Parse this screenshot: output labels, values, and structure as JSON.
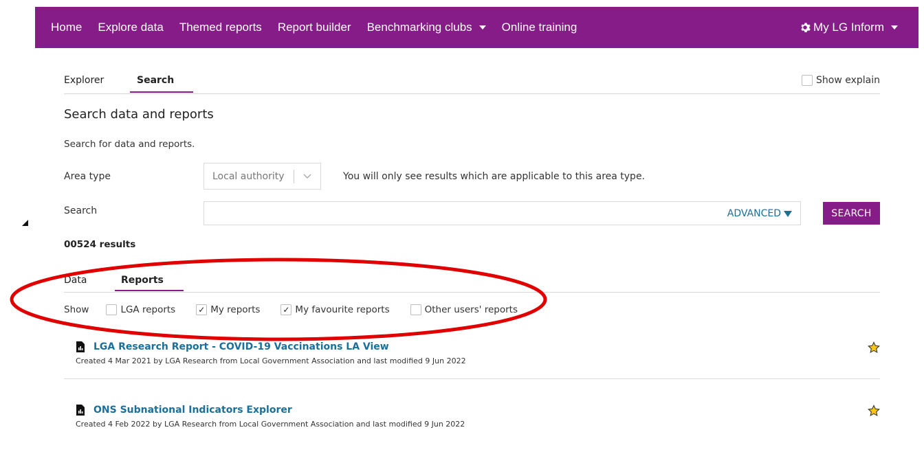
{
  "nav": {
    "items": [
      {
        "label": "Home",
        "dropdown": false
      },
      {
        "label": "Explore data",
        "dropdown": false
      },
      {
        "label": "Themed reports",
        "dropdown": false
      },
      {
        "label": "Report builder",
        "dropdown": false
      },
      {
        "label": "Benchmarking clubs",
        "dropdown": true
      },
      {
        "label": "Online training",
        "dropdown": false
      }
    ],
    "account_label": "My LG Inform",
    "bg_color": "#861c87"
  },
  "subtabs": {
    "explorer": "Explorer",
    "search": "Search",
    "active": "search",
    "show_explain": "Show explain"
  },
  "page": {
    "title": "Search data and reports",
    "intro": "Search for data and reports."
  },
  "form": {
    "area_type_label": "Area type",
    "area_type_value": "Local authority",
    "area_type_hint": "You will only see results which are applicable to this area type.",
    "search_label": "Search",
    "search_value": "",
    "advanced_label": "ADVANCED",
    "search_button": "SEARCH"
  },
  "results": {
    "count": "00524 results",
    "tabs": {
      "data": "Data",
      "reports": "Reports",
      "active": "reports"
    },
    "show_label": "Show",
    "filters": [
      {
        "label": "LGA reports",
        "checked": false
      },
      {
        "label": "My reports",
        "checked": true
      },
      {
        "label": "My favourite reports",
        "checked": true
      },
      {
        "label": "Other users' reports",
        "checked": false
      }
    ],
    "reports": [
      {
        "title": "LGA Research Report - COVID-19 Vaccinations LA View",
        "meta": "Created 4 Mar 2021 by LGA Research from Local Government Association and last modified 9 Jun 2022"
      },
      {
        "title": "ONS Subnational Indicators Explorer",
        "meta": "Created 4 Feb 2022 by LGA Research from Local Government Association and last modified 9 Jun 2022"
      }
    ]
  },
  "colors": {
    "accent": "#861c87",
    "link": "#1a6f9b",
    "annotation": "#e00000",
    "star": "#f5c518"
  }
}
